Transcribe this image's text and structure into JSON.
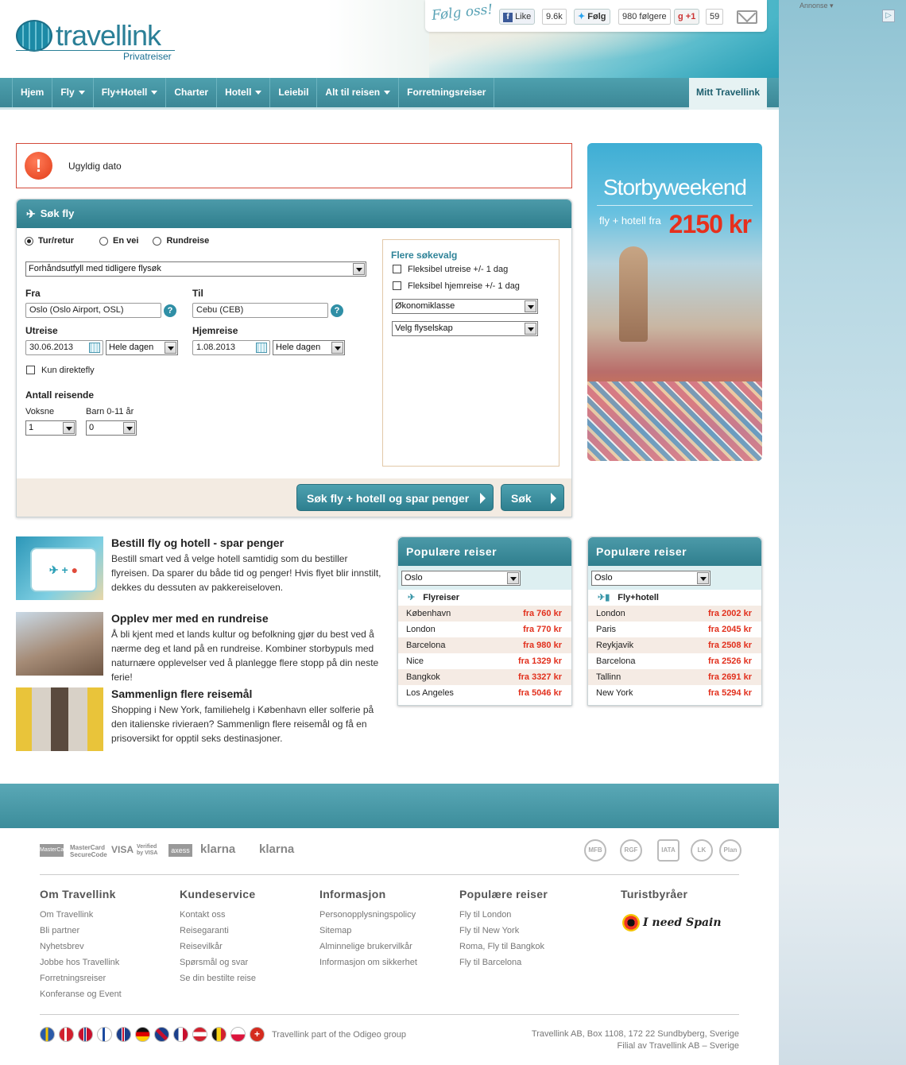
{
  "brand": {
    "name": "travellink",
    "sub": "Privatreiser"
  },
  "social": {
    "follow_text": "Følg oss!",
    "fb_label": "Like",
    "fb_count": "9.6k",
    "tw_label": "Følg",
    "tw_count": "980 følgere",
    "gplus_label": "+1",
    "gplus_count": "59"
  },
  "nav": {
    "items": [
      "Hjem",
      "Fly",
      "Fly+Hotell",
      "Charter",
      "Hotell",
      "Leiebil",
      "Alt til reisen",
      "Forretningsreiser"
    ],
    "mitt": "Mitt Travellink"
  },
  "error": {
    "text": "Ugyldig dato"
  },
  "search": {
    "title": "Søk fly",
    "trip_types": [
      "Tur/retur",
      "En vei",
      "Rundreise"
    ],
    "prefill": "Forhåndsutfyll med tidligere flysøk",
    "from_label": "Fra",
    "from_value": "Oslo (Oslo Airport, OSL)",
    "to_label": "Til",
    "to_value": "Cebu (CEB)",
    "out_label": "Utreise",
    "out_date": "30.06.2013",
    "out_time": "Hele dagen",
    "ret_label": "Hjemreise",
    "ret_date": "1.08.2013",
    "ret_time": "Hele dagen",
    "direct": "Kun direktefly",
    "pax_title": "Antall reisende",
    "adults_label": "Voksne",
    "adults_value": "1",
    "children_label": "Barn 0-11 år",
    "children_value": "0",
    "more_title": "Flere søkevalg",
    "flex_out": "Fleksibel utreise +/- 1 dag",
    "flex_ret": "Fleksibel hjemreise +/- 1 dag",
    "cabin": "Økonomiklasse",
    "airline": "Velg flyselskap",
    "btn_combo": "Søk fly + hotell og spar penger",
    "btn_fly": "Søk fly"
  },
  "ad": {
    "title": "Storbyweekend",
    "sub": "fly + hotell fra",
    "price": "2150 kr",
    "annonse": "Annonse"
  },
  "promos": [
    {
      "title": "Bestill fly og hotell - spar penger",
      "text": "Bestill smart ved å velge hotell samtidig som du bestiller flyreisen. Da sparer du både tid og penger! Hvis flyet blir innstilt, dekkes du dessuten av pakkereiseloven."
    },
    {
      "title": "Opplev mer med en rundreise",
      "text": "Å bli kjent med et lands kultur og befolkning gjør du best ved å nærme deg et land på en rundreise. Kombiner storbypuls med naturnære opplevelser ved å planlegge flere stopp på din neste ferie!"
    },
    {
      "title": "Sammenlign flere reisemål",
      "text": "Shopping i New York, familiehelg i København eller solferie på den italienske rivieraen? Sammenlign flere reisemål og få en prisoversikt for opptil seks destinasjoner."
    }
  ],
  "popular": [
    {
      "title": "Populære reiser",
      "select": "Oslo",
      "sub": "Flyreiser",
      "rows": [
        {
          "city": "København",
          "price": "fra 760 kr"
        },
        {
          "city": "London",
          "price": "fra 770 kr"
        },
        {
          "city": "Barcelona",
          "price": "fra 980 kr"
        },
        {
          "city": "Nice",
          "price": "fra 1329 kr"
        },
        {
          "city": "Bangkok",
          "price": "fra 3327 kr"
        },
        {
          "city": "Los Angeles",
          "price": "fra 5046 kr"
        }
      ]
    },
    {
      "title": "Populære reiser",
      "select": "Oslo",
      "sub": "Fly+hotell",
      "rows": [
        {
          "city": "London",
          "price": "fra 2002 kr"
        },
        {
          "city": "Paris",
          "price": "fra 2045 kr"
        },
        {
          "city": "Reykjavik",
          "price": "fra 2508 kr"
        },
        {
          "city": "Barcelona",
          "price": "fra 2526 kr"
        },
        {
          "city": "Tallinn",
          "price": "fra 2691 kr"
        },
        {
          "city": "New York",
          "price": "fra 5294 kr"
        }
      ]
    }
  ],
  "payments": [
    "MasterCard",
    "MasterCard SecureCode",
    "VISA",
    "Verified by VISA",
    "axess",
    "klarna",
    "klarna"
  ],
  "seals": [
    "MFB",
    "RGF",
    "IATA",
    "LK",
    "Plan"
  ],
  "footer": {
    "cols": [
      {
        "title": "Om Travellink",
        "links": [
          "Om Travellink",
          "Bli partner",
          "Nyhetsbrev",
          "Jobbe hos Travellink",
          "Forretningsreiser",
          "Konferanse og Event"
        ]
      },
      {
        "title": "Kundeservice",
        "links": [
          "Kontakt oss",
          "Reisegaranti",
          "Reisevilkår",
          "Spørsmål og svar",
          "Se din bestilte reise"
        ]
      },
      {
        "title": "Informasjon",
        "links": [
          "Personopplysningspolicy",
          "Sitemap",
          "Alminnelige brukervilkår",
          "Informasjon om sikkerhet"
        ]
      },
      {
        "title": "Populære reiser",
        "links": [
          "Fly til London",
          "Fly til New York",
          "Roma, Fly til Bangkok",
          "Fly til Barcelona"
        ]
      },
      {
        "title": "Turistbyråer",
        "links": []
      }
    ],
    "needspain": "I need Spain",
    "odigeo": "Travellink part of the Odigeo group",
    "address1": "Travellink AB, Box 1108, 172 22 Sundbyberg, Sverige",
    "address2": "Filial av Travellink AB – Sverige"
  },
  "colors": {
    "teal": "#3b8796",
    "price_red": "#e2301d",
    "error_red": "#d34a3a"
  }
}
